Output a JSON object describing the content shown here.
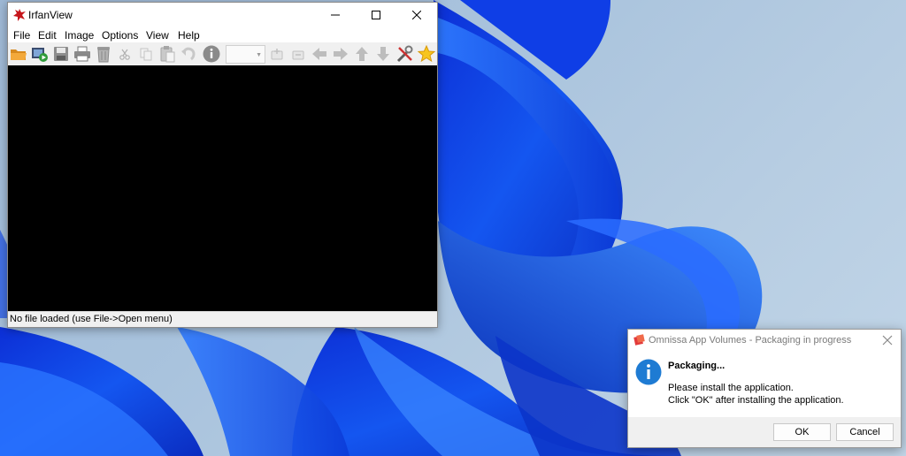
{
  "desktop": {
    "wallpaper": "Windows 11 Bloom",
    "accent": "#1a4fe6"
  },
  "irfanview": {
    "title": "IrfanView",
    "menu": [
      "File",
      "Edit",
      "Image",
      "Options",
      "View",
      "Help"
    ],
    "toolbar_icons": [
      "open-folder-icon",
      "slideshow-icon",
      "save-icon",
      "print-icon",
      "delete-icon",
      "cut-icon",
      "copy-icon",
      "paste-icon",
      "undo-icon",
      "info-icon",
      "zoom-combo",
      "zoom-in-icon",
      "zoom-out-icon",
      "previous-icon",
      "next-icon",
      "up-icon",
      "down-icon",
      "tools-icon",
      "favorites-star-icon"
    ],
    "zoom_value": "",
    "status": "No file loaded (use File->Open menu)"
  },
  "dialog": {
    "title": "Omnissa App Volumes - Packaging in progress",
    "heading": "Packaging...",
    "line1": "Please install the application.",
    "line2": "Click \"OK\" after installing the application.",
    "ok_label": "OK",
    "cancel_label": "Cancel"
  },
  "colors": {
    "info_blue": "#1e7bd3",
    "omnissa_red": "#e23a3a"
  }
}
